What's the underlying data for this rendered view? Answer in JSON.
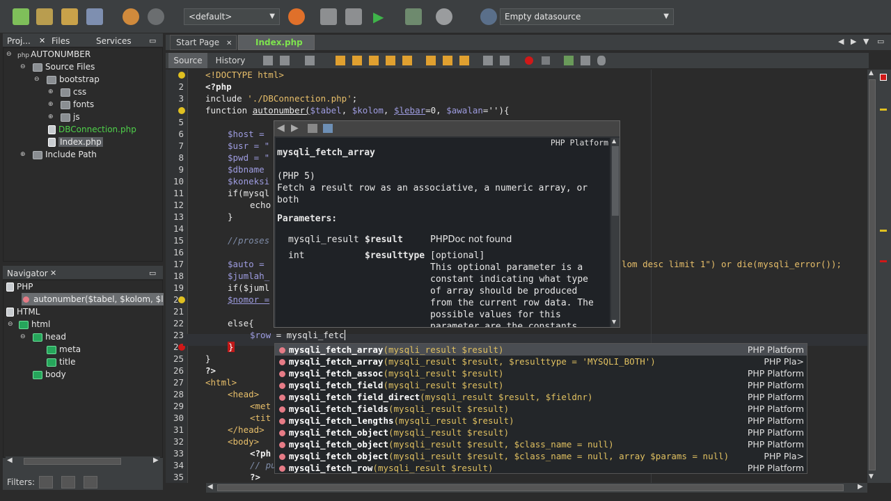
{
  "toolbar": {
    "config_combo": "<default>",
    "datasource_combo": "Empty datasource"
  },
  "projects_panel": {
    "tabs": [
      "Proj...",
      "Files",
      "Services"
    ],
    "tree": [
      {
        "label": "AUTONUMBER",
        "badge": "php"
      },
      {
        "label": "Source Files"
      },
      {
        "label": "bootstrap"
      },
      {
        "label": "css"
      },
      {
        "label": "fonts"
      },
      {
        "label": "js"
      },
      {
        "label": "DBConnection.php"
      },
      {
        "label": "Index.php"
      },
      {
        "label": "Include Path"
      }
    ]
  },
  "navigator": {
    "title": "Navigator",
    "items": [
      "PHP",
      "autonumber($tabel, $kolom, $le",
      "HTML",
      "html",
      "head",
      "meta",
      "title",
      "body"
    ]
  },
  "filters_label": "Filters:",
  "editor": {
    "tabs": [
      {
        "label": "Start Page"
      },
      {
        "label": "Index.php"
      }
    ],
    "source_tab": "Source",
    "history_tab": "History",
    "line_numbers": [
      "",
      "2",
      "3",
      "4",
      "5",
      "6",
      "7",
      "8",
      "9",
      "10",
      "11",
      "12",
      "13",
      "14",
      "15",
      "16",
      "17",
      "18",
      "19",
      "20",
      "21",
      "22",
      "23",
      "24",
      "25",
      "26",
      "27",
      "28",
      "29",
      "30",
      "31",
      "32",
      "33",
      "34",
      "35"
    ],
    "line1": "<!DOCTYPE html>",
    "line2": "<?php",
    "line3_a": "include ",
    "line3_b": "'./DBConnection.php'",
    "line3_c": ";",
    "line4_a": "function ",
    "line4_b": "autonumber(",
    "line4_c": "$tabel",
    "line4_d": ", ",
    "line4_e": "$kolom",
    "line4_f": ", ",
    "line4_g": "$lebar",
    "line4_h": "=0, ",
    "line4_i": "$awalan",
    "line4_j": "=''){",
    "line6": "$host =",
    "line7": "$usr = \"",
    "line8": "$pwd = \"",
    "line9": "$dbname",
    "line10": "$koneksi",
    "line11": "if(mysql",
    "line12": "echo",
    "line13": "}",
    "line15": "//proses a",
    "line17_a": "$auto =",
    "line17_b": "lom desc limit 1\") or die(mysqli_error());",
    "line18": "$jumlah_",
    "line19": "if($juml",
    "line20": "$nomor =",
    "line22": "else{",
    "line23_a": "$row",
    "line23_b": " = mysqli_fetc",
    "line24": "}",
    "line25": "}",
    "line26": "?>",
    "line27": "<html>",
    "line28": "<head>",
    "line29": "<met",
    "line30": "<tit",
    "line31": "</head>",
    "line32": "<body>",
    "line33": "<?ph",
    "line34": "// pu",
    "line35": "?>"
  },
  "doc_popup": {
    "platform": "PHP Platform",
    "name": "mysqli_fetch_array",
    "version": "(PHP 5)",
    "desc1": "Fetch a result row as an associative, a numeric array, or",
    "desc2": "both",
    "params_title": "Parameters:",
    "p1_type": "mysqli_result",
    "p1_name": "$result",
    "p1_desc": "PHPDoc not found",
    "p2_type": "int",
    "p2_name": "$resulttype",
    "p2_desc1": "[optional]",
    "p2_desc2": "This optional parameter is a",
    "p2_desc3": "constant indicating what type",
    "p2_desc4": "of array should be produced",
    "p2_desc5": "from the current row data. The",
    "p2_desc6": "possible values for this",
    "p2_desc7": "parameter are the constants"
  },
  "completion": [
    {
      "fn": "mysqli_fetch_array",
      "params": "(mysqli_result $result)",
      "src": "PHP Platform"
    },
    {
      "fn": "mysqli_fetch_array",
      "params": "(mysqli_result $result, $resulttype = 'MYSQLI_BOTH')",
      "src": "PHP Pla>"
    },
    {
      "fn": "mysqli_fetch_assoc",
      "params": "(mysqli_result $result)",
      "src": "PHP Platform"
    },
    {
      "fn": "mysqli_fetch_field",
      "params": "(mysqli_result $result)",
      "src": "PHP Platform"
    },
    {
      "fn": "mysqli_fetch_field_direct",
      "params": "(mysqli_result $result, $fieldnr)",
      "src": "PHP Platform"
    },
    {
      "fn": "mysqli_fetch_fields",
      "params": "(mysqli_result $result)",
      "src": "PHP Platform"
    },
    {
      "fn": "mysqli_fetch_lengths",
      "params": "(mysqli_result $result)",
      "src": "PHP Platform"
    },
    {
      "fn": "mysqli_fetch_object",
      "params": "(mysqli_result $result)",
      "src": "PHP Platform"
    },
    {
      "fn": "mysqli_fetch_object",
      "params": "(mysqli_result $result, $class_name = null)",
      "src": "PHP Platform"
    },
    {
      "fn": "mysqli_fetch_object",
      "params": "(mysqli_result $result, $class_name = null, array $params = null)",
      "src": "PHP Pla>"
    },
    {
      "fn": "mysqli_fetch_row",
      "params": "(mysqli_result $result)",
      "src": "PHP Platform"
    }
  ]
}
